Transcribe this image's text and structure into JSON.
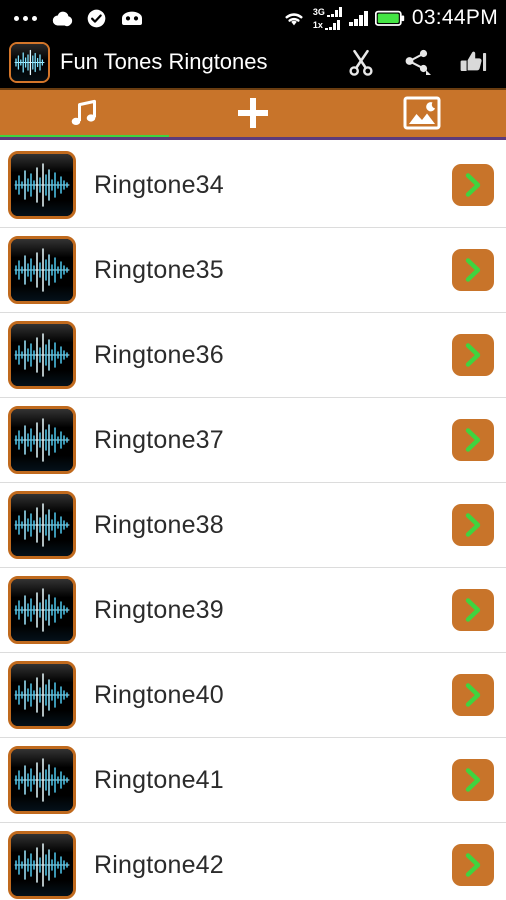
{
  "status_bar": {
    "left_icons": [
      "more-dots-icon",
      "cloud-icon",
      "check-circle-icon",
      "android-robot-icon"
    ],
    "wifi_icon": "wifi-icon",
    "signal_3g_label": "3G",
    "signal_1x_label": "1x",
    "battery_icon": "battery-full-icon",
    "time": "03:44PM",
    "background_color": "#000000"
  },
  "action_bar": {
    "app_icon": "waveform-app-icon",
    "title": "Fun Tones Ringtones",
    "actions": [
      {
        "name": "cut-icon",
        "label": "Cut"
      },
      {
        "name": "share-icon",
        "label": "Share"
      },
      {
        "name": "thumbs-up-icon",
        "label": "Rate"
      }
    ],
    "background_color": "#000000"
  },
  "tabs": {
    "accent_color": "#c8742a",
    "indicator_color": "#3fd43f",
    "baseline_color": "#5c3b7a",
    "items": [
      {
        "icon": "music-note-icon",
        "label": "Ringtones",
        "active": true
      },
      {
        "icon": "plus-icon",
        "label": "Add",
        "active": false
      },
      {
        "icon": "image-icon",
        "label": "Wallpapers",
        "active": false
      }
    ]
  },
  "list": {
    "button_color": "#c8742a",
    "chevron_color": "#3fd43f",
    "thumb_border_color": "#c06a1e",
    "items": [
      {
        "name": "Ringtone34",
        "thumbnail": "waveform-thumb-icon",
        "action": "open-chevron-icon"
      },
      {
        "name": "Ringtone35",
        "thumbnail": "waveform-thumb-icon",
        "action": "open-chevron-icon"
      },
      {
        "name": "Ringtone36",
        "thumbnail": "waveform-thumb-icon",
        "action": "open-chevron-icon"
      },
      {
        "name": "Ringtone37",
        "thumbnail": "waveform-thumb-icon",
        "action": "open-chevron-icon"
      },
      {
        "name": "Ringtone38",
        "thumbnail": "waveform-thumb-icon",
        "action": "open-chevron-icon"
      },
      {
        "name": "Ringtone39",
        "thumbnail": "waveform-thumb-icon",
        "action": "open-chevron-icon"
      },
      {
        "name": "Ringtone40",
        "thumbnail": "waveform-thumb-icon",
        "action": "open-chevron-icon"
      },
      {
        "name": "Ringtone41",
        "thumbnail": "waveform-thumb-icon",
        "action": "open-chevron-icon"
      },
      {
        "name": "Ringtone42",
        "thumbnail": "waveform-thumb-icon",
        "action": "open-chevron-icon"
      }
    ]
  }
}
